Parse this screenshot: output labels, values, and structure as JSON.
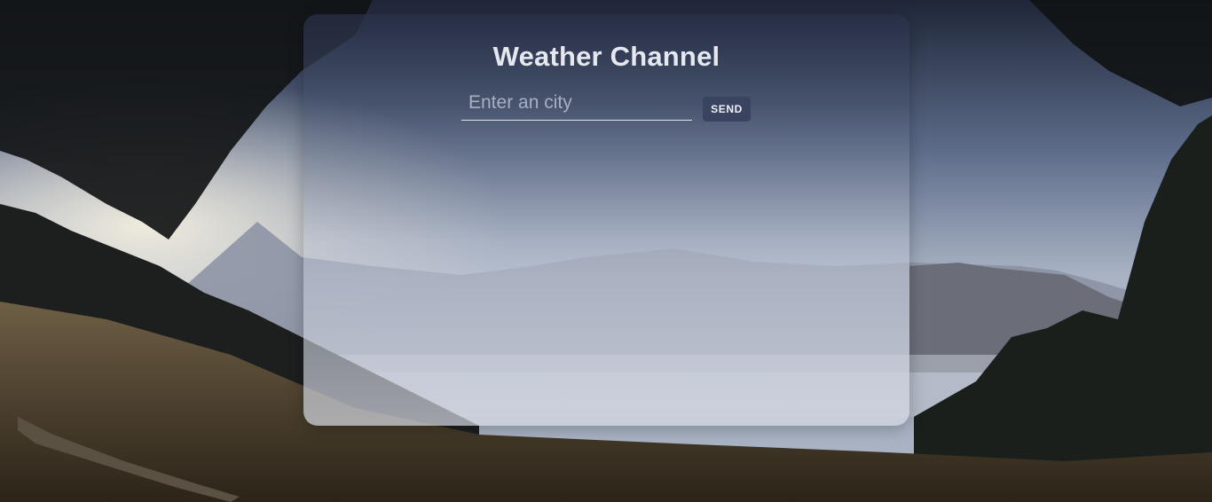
{
  "app": {
    "title": "Weather Channel"
  },
  "search": {
    "placeholder": "Enter an city",
    "value": "",
    "send_label": "SEND"
  },
  "colors": {
    "card_top": "#283048",
    "button_bg": "#3a4360",
    "text_light": "#e6e8f0"
  }
}
